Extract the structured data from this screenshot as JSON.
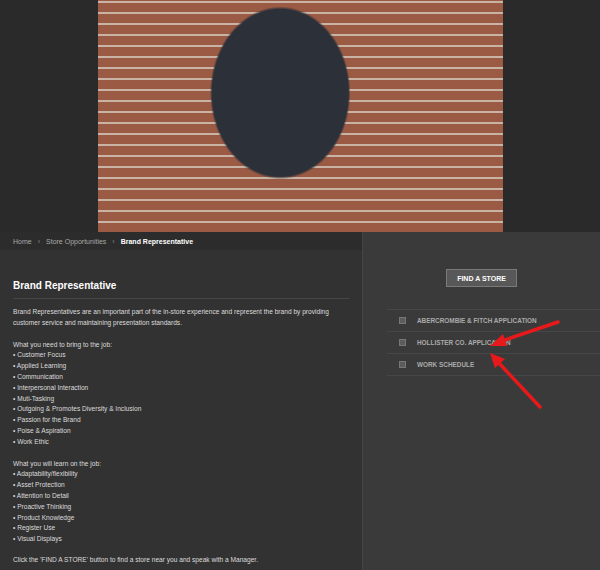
{
  "breadcrumb": {
    "separator": "›",
    "items": [
      {
        "label": "Home",
        "current": false
      },
      {
        "label": "Store Opportunities",
        "current": false
      },
      {
        "label": "Brand Representative",
        "current": true
      }
    ]
  },
  "content": {
    "title": "Brand Representative",
    "intro": "Brand Representatives are an important part of the in-store experience and represent the brand by providing customer service and maintaining presentation standards.",
    "sections": [
      {
        "heading": "What you need to bring to the job:",
        "bullet": "•",
        "items": [
          "Customer Focus",
          "Applied Learning",
          "Communication",
          "Interpersonal Interaction",
          "Muti-Tasking",
          "Outgoing & Promotes Diversity & Inclusion",
          "Passion for the Brand",
          "Poise & Aspiration",
          "Work Ethic"
        ]
      },
      {
        "heading": "What you will learn on the job:",
        "bullet": "•",
        "items": [
          "Adaptability/flexibility",
          "Asset Protection",
          "Attention to Detail",
          "Proactive Thinking",
          "Product Knowledge",
          "Register Use",
          "Visual Displays"
        ]
      }
    ],
    "footer": "Click the 'FIND A STORE' button to find a store near you and speak with a Manager."
  },
  "sidebar": {
    "button": "FIND A STORE",
    "links": [
      "ABERCROMBIE & FITCH APPLICATION",
      "HOLLISTER CO. APPLICATION",
      "WORK SCHEDULE"
    ]
  }
}
